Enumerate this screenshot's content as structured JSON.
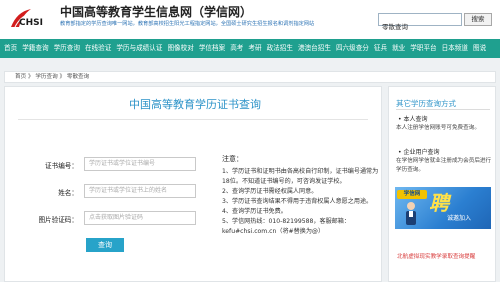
{
  "header": {
    "logo_text": "CHSI",
    "title": "中国高等教育学生信息网（学信网）",
    "subtitle": "教育部指定的学历查询唯一网站，教育部高校招生阳光工程指定网站，全国硕士研究生招生报名和调剂指定网站",
    "search_value": "零散查询",
    "search_button": "搜索"
  },
  "nav": {
    "items": [
      "首页",
      "学籍查询",
      "学历查询",
      "在线验证",
      "学历与成绩认证",
      "图像校对",
      "学信档案",
      "高考",
      "考研",
      "政法招生",
      "港澳台招生",
      "四六级查分",
      "征兵",
      "就业",
      "学职平台",
      "日本频道",
      "图说"
    ]
  },
  "breadcrumb": "首页 》 学历查询 》 零散查询",
  "form": {
    "title": "中国高等教育学历证书查询",
    "cert_label": "证书编号：",
    "cert_placeholder": "学历证书或学位证书编号",
    "name_label": "姓名：",
    "name_placeholder": "学历证书或学位证书上的姓名",
    "captcha_label": "图片验证码：",
    "captcha_placeholder": "点击获取图片验证码",
    "submit": "查询"
  },
  "notes": {
    "title": "注意：",
    "items": [
      "1、学历证书和证明书由各高校自行印制，证书编号通常为18位。不知道证书编号的，可咨询发证学校。",
      "2、查询学历证书需经权属人同意。",
      "3、学历证书查询结果不得用于违背权属人意愿之用途。",
      "4、查询学历证书免费。",
      "5、学信网热线：010-82199588，客服邮箱：kefu#chsi.com.cn（将#替换为@）"
    ]
  },
  "sidebar": {
    "title": "其它学历查询方式",
    "personal_head": "• 本人查询",
    "personal_text": "本人注册学信网账号可免费查询。",
    "enterprise_head": "• 企业用户查询",
    "enterprise_text": "在学信网学信就业注册成为会员后进行学历查询。",
    "banner_badge": "学信网",
    "banner_big": "聘",
    "banner_small": "诚邀加入",
    "red_link": "北航虚拟现实教学录取查询提醒"
  },
  "colors": {
    "nav_bg": "#1fa08f",
    "accent_blue": "#2c93c8",
    "button_blue": "#27a3c9",
    "page_bg": "#eef1f3",
    "link_red": "#d83a3a"
  }
}
